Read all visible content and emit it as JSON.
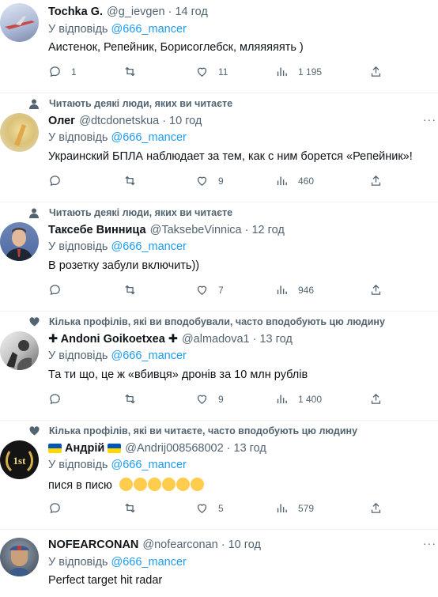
{
  "colors": {
    "accent": "#1d9bf0",
    "muted": "#536471",
    "text": "#0f1419"
  },
  "common": {
    "reply_prefix": "У відповідь",
    "reply_to": "@666_mancer",
    "dot": "·",
    "more": "···"
  },
  "tweets": [
    {
      "name": "Tochka G.",
      "handle": "@g_ievgen",
      "time": "14 год",
      "text": "Аистенок, Репейник, Борисоглебск, мляяяяять )",
      "replies": "1",
      "retweets": "",
      "likes": "11",
      "views": "1 195",
      "social": ""
    },
    {
      "name": "Олег",
      "handle": "@dtcdonetskua",
      "time": "10 год",
      "text": "Украинский БПЛА наблюдает за тем, как с ним борется «Репейник»!",
      "replies": "",
      "retweets": "",
      "likes": "9",
      "views": "460",
      "social": "Читають деякі люди, яких ви читаєте"
    },
    {
      "name": "Таксебе Винница",
      "handle": "@TaksebeVinnica",
      "time": "12 год",
      "text": "В розетку забули включить))",
      "replies": "",
      "retweets": "",
      "likes": "7",
      "views": "946",
      "social": "Читають деякі люди, яких ви читаєте"
    },
    {
      "name": "✚ Andoni Goikoetxea ✚",
      "handle": "@almadova1",
      "time": "13 год",
      "text": "Та ти що, це ж «вбивця» дронів за 10 млн рублів",
      "replies": "",
      "retweets": "",
      "likes": "9",
      "views": "1 400",
      "social": "Кілька профілів, які ви вподобували, часто вподобують цю людину"
    },
    {
      "name": "Андрій",
      "handle": "@Andrij008568002",
      "time": "13 год",
      "text": "пися в писю",
      "replies": "",
      "retweets": "",
      "likes": "5",
      "views": "579",
      "social": "Кілька профілів, які ви читаєте, часто вподобують цю людину"
    },
    {
      "name": "NOFEARCONAN",
      "handle": "@nofearconan",
      "time": "10 год",
      "text": "Perfect target hit radar",
      "social": ""
    }
  ]
}
